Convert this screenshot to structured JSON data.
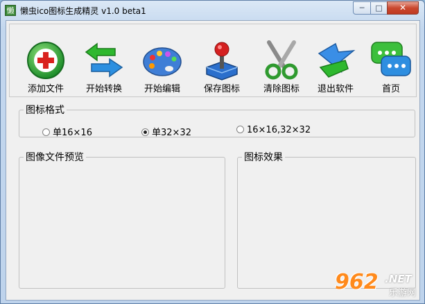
{
  "window": {
    "title": "懒虫ico图标生成精灵 v1.0 beta1",
    "app_icon_char": "懒",
    "min_glyph": "─",
    "max_glyph": "□",
    "close_glyph": "✕"
  },
  "toolbar": {
    "items": [
      {
        "label": "添加文件",
        "icon": "add-file-icon"
      },
      {
        "label": "开始转换",
        "icon": "convert-arrows-icon"
      },
      {
        "label": "开始编辑",
        "icon": "palette-icon"
      },
      {
        "label": "保存图标",
        "icon": "joystick-icon"
      },
      {
        "label": "清除图标",
        "icon": "scissors-icon"
      },
      {
        "label": "退出软件",
        "icon": "exit-arrow-icon"
      },
      {
        "label": "首页",
        "icon": "chat-bubbles-icon"
      }
    ]
  },
  "format_group": {
    "title": "图标格式",
    "options": [
      {
        "label": "单16×16",
        "selected": false
      },
      {
        "label": "单32×32",
        "selected": true
      },
      {
        "label": "16×16,32×32",
        "selected": false
      }
    ]
  },
  "preview_group": {
    "title": "图像文件预览"
  },
  "effect_group": {
    "title": "图标效果"
  },
  "watermark": {
    "number": "962",
    "suffix": ".NET",
    "site": "乐游网"
  }
}
